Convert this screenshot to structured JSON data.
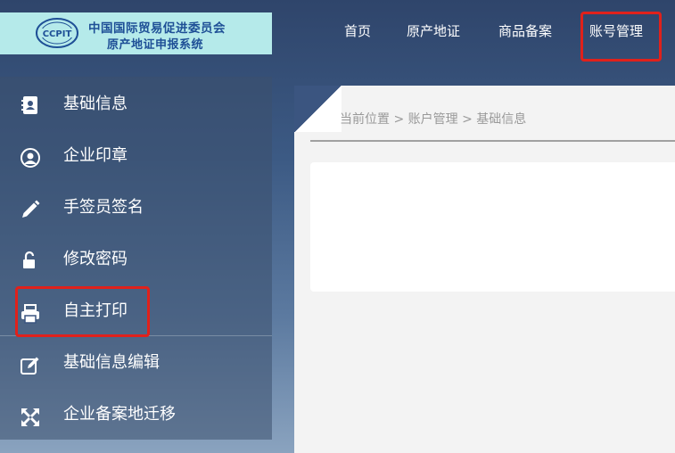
{
  "header": {
    "org_name": "中国国际贸易促进委员会",
    "system_name": "原产地证申报系统",
    "logo_text": "CCPIT",
    "nav": [
      {
        "label": "首页"
      },
      {
        "label": "原产地证"
      },
      {
        "label": "商品备案"
      },
      {
        "label": "账号管理"
      }
    ]
  },
  "sidebar": {
    "items": [
      {
        "label": "基础信息",
        "icon": "contact-book-icon"
      },
      {
        "label": "企业印章",
        "icon": "user-circle-icon"
      },
      {
        "label": "手签员签名",
        "icon": "pencil-icon"
      },
      {
        "label": "修改密码",
        "icon": "unlock-icon"
      },
      {
        "label": "自主打印",
        "icon": "printer-icon"
      },
      {
        "label": "基础信息编辑",
        "icon": "edit-icon"
      },
      {
        "label": "企业备案地迁移",
        "icon": "expand-arrows-icon"
      }
    ]
  },
  "breadcrumb": "当前位置 > 账户管理 > 基础信息",
  "colors": {
    "highlight": "#e0211b",
    "logo_bg": "#b5eaea",
    "logo_text": "#1e4f96"
  }
}
